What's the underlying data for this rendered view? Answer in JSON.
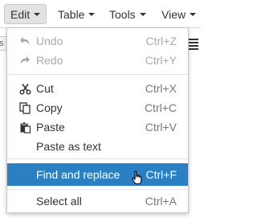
{
  "menubar": {
    "items": [
      {
        "label": "Edit"
      },
      {
        "label": "Table"
      },
      {
        "label": "Tools"
      },
      {
        "label": "View"
      }
    ]
  },
  "toolbar": {
    "left_stub_text": "ts"
  },
  "edit_menu": {
    "items": [
      {
        "label": "Undo",
        "shortcut": "Ctrl+Z",
        "icon": "undo-icon",
        "disabled": true
      },
      {
        "label": "Redo",
        "shortcut": "Ctrl+Y",
        "icon": "redo-icon",
        "disabled": true
      },
      {
        "label": "Cut",
        "shortcut": "Ctrl+X",
        "icon": "scissors-icon"
      },
      {
        "label": "Copy",
        "shortcut": "Ctrl+C",
        "icon": "copy-icon"
      },
      {
        "label": "Paste",
        "shortcut": "Ctrl+V",
        "icon": "paste-icon"
      },
      {
        "label": "Paste as text",
        "shortcut": ""
      },
      {
        "label": "Find and replace",
        "shortcut": "Ctrl+F",
        "highlighted": true
      },
      {
        "label": "Select all",
        "shortcut": "Ctrl+A"
      }
    ]
  },
  "colors": {
    "highlight": "#2b7fc3",
    "menubar_active": "#e3e3e3",
    "disabled_text": "#aaaaaa",
    "shortcut_text": "#777777"
  }
}
